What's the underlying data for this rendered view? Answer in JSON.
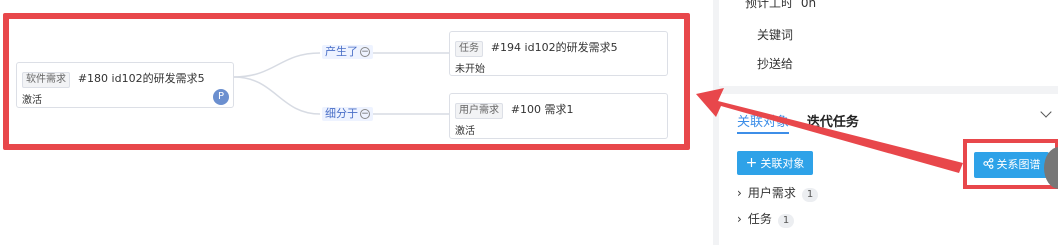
{
  "graph": {
    "root": {
      "type_tag": "软件需求",
      "title": "#180 id102的研发需求5",
      "status": "激活",
      "avatar": "P"
    },
    "edges": [
      {
        "label": "产生了",
        "toggle": "−"
      },
      {
        "label": "细分于",
        "toggle": "−"
      }
    ],
    "children": [
      {
        "type_tag": "任务",
        "title": "#194 id102的研发需求5",
        "status": "未开始"
      },
      {
        "type_tag": "用户需求",
        "title": "#100 需求1",
        "status": "激活"
      }
    ]
  },
  "details": {
    "estimate_label": "预计工时",
    "estimate_value": "0h",
    "keywords_label": "关键词",
    "cc_label": "抄送给"
  },
  "relations": {
    "tabs": [
      {
        "label": "关联对象",
        "active": true
      },
      {
        "label": "迭代任务",
        "active": false
      }
    ],
    "add_button": "关联对象",
    "graph_button": "关系图谱",
    "groups": [
      {
        "label": "用户需求",
        "count": "1"
      },
      {
        "label": "任务",
        "count": "1"
      }
    ]
  },
  "colors": {
    "accent": "#2ea2e8",
    "annotation_red": "#e8474b",
    "link_blue": "#3d8ee8"
  }
}
